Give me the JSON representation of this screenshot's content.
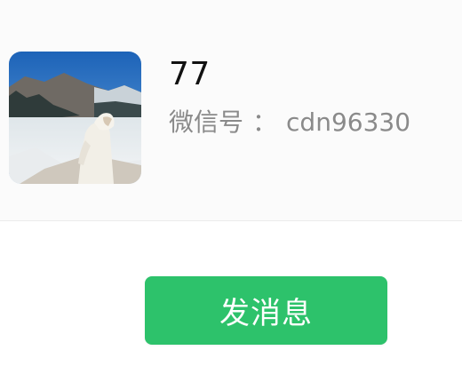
{
  "profile": {
    "nickname": "77",
    "wechat_id_label": "微信号",
    "wechat_id_separator": "：",
    "wechat_id_value": "cdn96330",
    "avatar": "avatar-photo-person-in-white-coat-by-snowy-mountain-lake"
  },
  "actions": {
    "send_message_label": "发消息"
  },
  "colors": {
    "accent_green": "#2dc26b",
    "nickname_text": "#111111",
    "secondary_text": "#8a8a8a",
    "card_background": "#fbfbfb"
  }
}
